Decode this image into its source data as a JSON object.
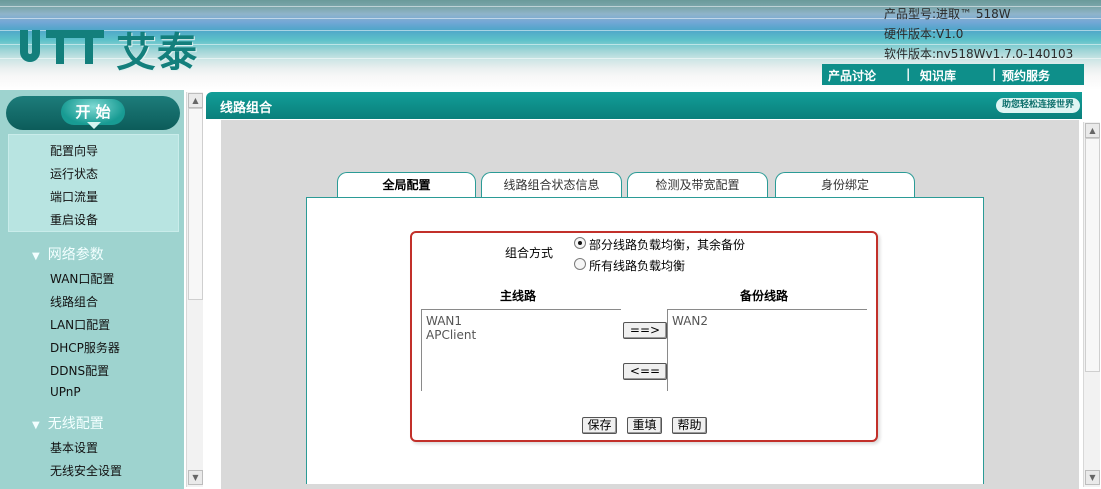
{
  "header": {
    "brand": "艾泰",
    "product_model": "产品型号:进取™ 518W",
    "hardware_version": "硬件版本:V1.0",
    "software_version": "软件版本:nv518Wv1.7.0-140103",
    "links": [
      "产品讨论",
      "知识库",
      "预约服务"
    ],
    "separator": "|"
  },
  "sidebar": {
    "start_label": "开 始",
    "quick_items": [
      "配置向导",
      "运行状态",
      "端口流量",
      "重启设备"
    ],
    "groups": [
      {
        "label": "网络参数",
        "items": [
          "WAN口配置",
          "线路组合",
          "LAN口配置",
          "DHCP服务器",
          "DDNS配置",
          "UPnP"
        ]
      },
      {
        "label": "无线配置",
        "items": [
          "基本设置",
          "无线安全设置"
        ]
      }
    ]
  },
  "page": {
    "title": "线路组合",
    "slogan": "助您轻松连接世界"
  },
  "tabs": [
    "全局配置",
    "线路组合状态信息",
    "检测及带宽配置",
    "身份绑定"
  ],
  "active_tab": "全局配置",
  "form": {
    "mode_label": "组合方式",
    "mode_options": [
      "部分线路负载均衡，其余备份",
      "所有线路负载均衡"
    ],
    "mode_selected": "部分线路负载均衡，其余备份",
    "main_line_header": "主线路",
    "backup_line_header": "备份线路",
    "main_lines": [
      "WAN1",
      "APClient"
    ],
    "backup_lines": [
      "WAN2"
    ],
    "move_right_label": "==>",
    "move_left_label": "<==",
    "save_label": "保存",
    "reset_label": "重填",
    "help_label": "帮助"
  },
  "colors": {
    "accent": "#0e8f8a",
    "sidebar_bg": "#9ed3cf",
    "highlight_border": "#c2302a"
  }
}
